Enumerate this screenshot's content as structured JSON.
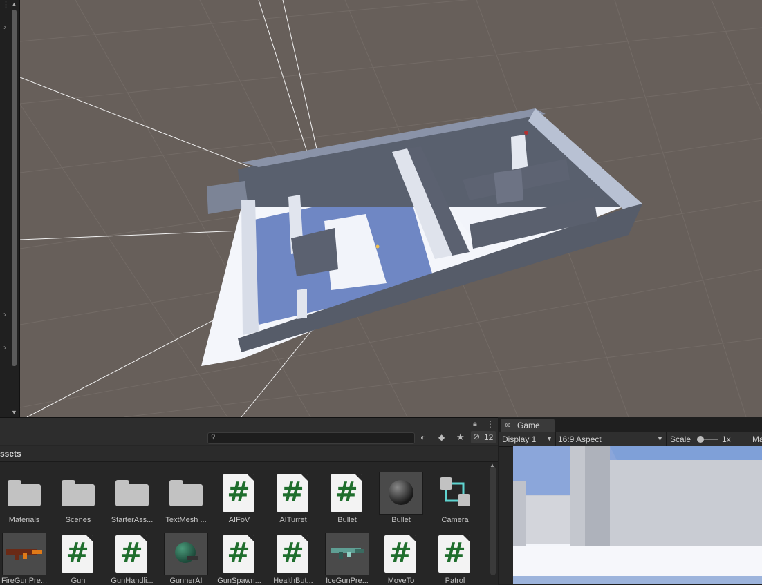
{
  "project": {
    "title": "ssets",
    "search": {
      "placeholder": "",
      "value": ""
    },
    "hidden_count": "12",
    "assets": [
      {
        "label": "Materials",
        "kind": "folder"
      },
      {
        "label": "Scenes",
        "kind": "folder"
      },
      {
        "label": "StarterAss...",
        "kind": "folder"
      },
      {
        "label": "TextMesh ...",
        "kind": "folder"
      },
      {
        "label": "AIFoV",
        "kind": "script"
      },
      {
        "label": "AITurret",
        "kind": "script"
      },
      {
        "label": "Bullet",
        "kind": "script"
      },
      {
        "label": "Bullet",
        "kind": "sphere"
      },
      {
        "label": "Camera",
        "kind": "camera"
      },
      {
        "label": "FireGunPre...",
        "kind": "gun-orange"
      },
      {
        "label": "Gun",
        "kind": "script"
      },
      {
        "label": "GunHandli...",
        "kind": "script"
      },
      {
        "label": "GunnerAI",
        "kind": "gunner"
      },
      {
        "label": "GunSpawn...",
        "kind": "script"
      },
      {
        "label": "HealthBut...",
        "kind": "script"
      },
      {
        "label": "IceGunPre...",
        "kind": "gun-teal"
      },
      {
        "label": "MoveTo",
        "kind": "script"
      },
      {
        "label": "Patrol",
        "kind": "script"
      }
    ],
    "script_glyph": "#"
  },
  "game": {
    "tab_label": "Game",
    "display": "Display 1",
    "aspect": "16:9 Aspect",
    "scale_label": "Scale",
    "scale_value": "1x",
    "cut_label": "Ma"
  },
  "colors": {
    "scene_bg": "#675f5a",
    "panel_bg": "#262626",
    "script_hash": "#1f6e2d"
  }
}
